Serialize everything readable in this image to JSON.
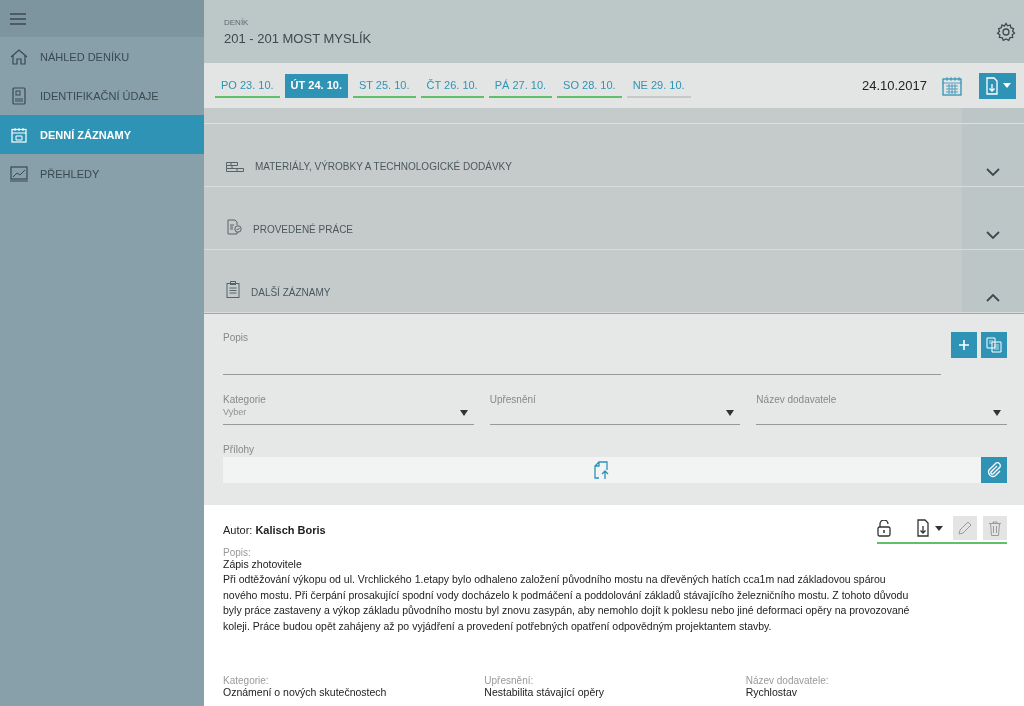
{
  "sidebar": {
    "items": [
      {
        "label": "NÁHLED DENÍKU",
        "selected": false
      },
      {
        "label": "IDENTIFIKAČNÍ ÚDAJE",
        "selected": false
      },
      {
        "label": "DENNÍ ZÁZNAMY",
        "selected": true
      },
      {
        "label": "PŘEHLEDY",
        "selected": false
      }
    ]
  },
  "header": {
    "caption": "DENÍK",
    "title": "201 - 201 MOST MYSLÍK"
  },
  "days": [
    {
      "label": "PO 23. 10.",
      "selected": false,
      "filled": true
    },
    {
      "label": "ÚT 24. 10.",
      "selected": true,
      "filled": true
    },
    {
      "label": "ST 25. 10.",
      "selected": false,
      "filled": true
    },
    {
      "label": "ČT 26. 10.",
      "selected": false,
      "filled": true
    },
    {
      "label": "PÁ 27. 10.",
      "selected": false,
      "filled": true
    },
    {
      "label": "SO 28. 10.",
      "selected": false,
      "filled": true
    },
    {
      "label": "NE 29. 10.",
      "selected": false,
      "filled": false
    }
  ],
  "date": "24.10.2017",
  "sections": [
    {
      "title": "MATERIÁLY, VÝROBKY A TECHNOLOGICKÉ DODÁVKY",
      "expanded": false
    },
    {
      "title": "PROVEDENÉ PRÁCE",
      "expanded": false
    },
    {
      "title": "DALŠÍ ZÁZNAMY",
      "expanded": true
    }
  ],
  "form": {
    "description_label": "Popis",
    "selects": [
      {
        "label": "Kategorie",
        "placeholder": "Vyber"
      },
      {
        "label": "Upřesnění"
      },
      {
        "label": "Název dodavatele"
      }
    ],
    "attachments_label": "Přílohy"
  },
  "entry": {
    "author_label": "Autor:",
    "author": "Kalisch Boris",
    "locked": false,
    "description_label": "Popis:",
    "description_title": "Zápis zhotovitele",
    "description": "Při odtěžování výkopu od ul. Vrchlického 1.etapy bylo odhaleno založení původního mostu na dřevěných hatích cca1m nad základovou spárou nového mostu. Při čerpání prosakující spodní vody docházelo k podmáčení a poddolování základů stávajícího železničního mostu. Z tohoto důvodu byly práce zastaveny a výkop základu původního mostu byl znovu zasypán, aby nemohlo dojít k poklesu nebo jiné deformaci opěry na provozované koleji. Práce budou opět zahájeny až po vyjádření a provedení potřebných opatření odpovědným projektantem stavby.",
    "fields": [
      {
        "label": "Kategorie:",
        "value": "Oznámení o nových skutečnostech"
      },
      {
        "label": "Upřesnění:",
        "value": "Nestabilita stávající opěry"
      },
      {
        "label": "Název dodavatele:",
        "value": "Rychlostav"
      }
    ]
  }
}
